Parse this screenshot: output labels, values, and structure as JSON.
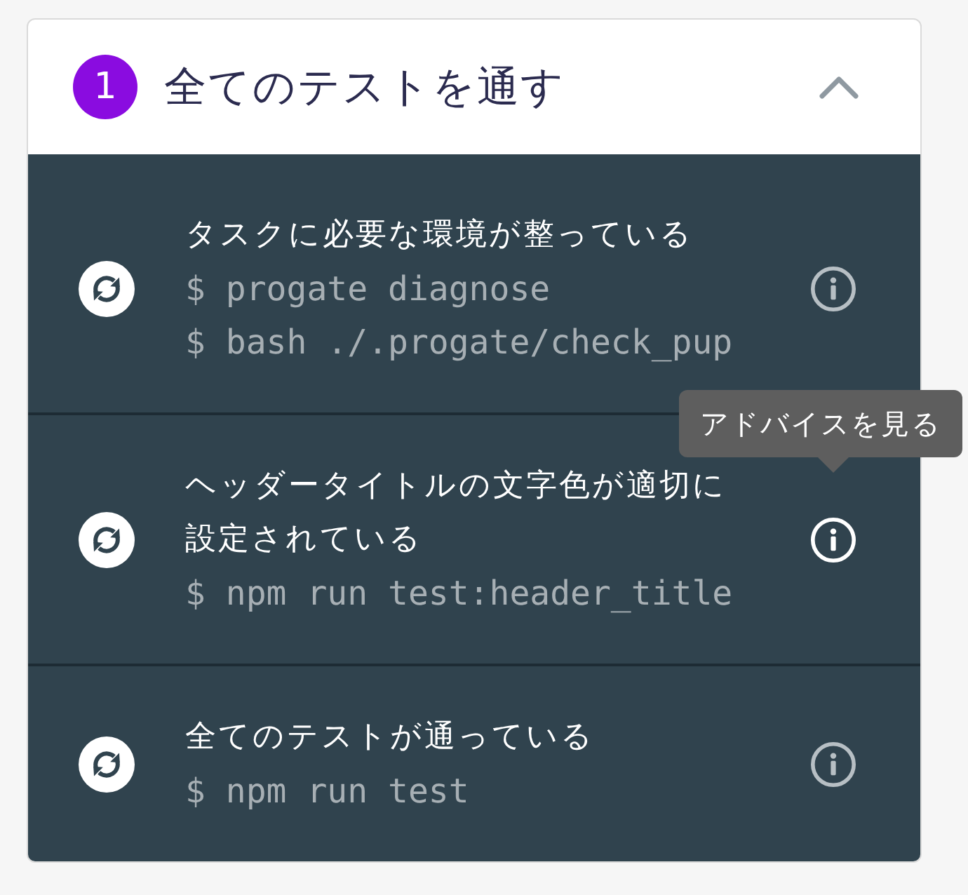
{
  "step": {
    "number": "1",
    "title": "全てのテストを通す",
    "expanded": true
  },
  "tests": [
    {
      "title": "タスクに必要な環境が整っている",
      "commands": [
        "$ progate diagnose",
        "$ bash ./.progate/check_pup"
      ],
      "hovered": false
    },
    {
      "title": "ヘッダータイトルの文字色が適切に設定されている",
      "commands": [
        "$ npm run test:header_title"
      ],
      "hovered": true
    },
    {
      "title": "全てのテストが通っている",
      "commands": [
        "$ npm run test"
      ],
      "hovered": false
    }
  ],
  "tooltip": {
    "text": "アドバイスを見る"
  }
}
